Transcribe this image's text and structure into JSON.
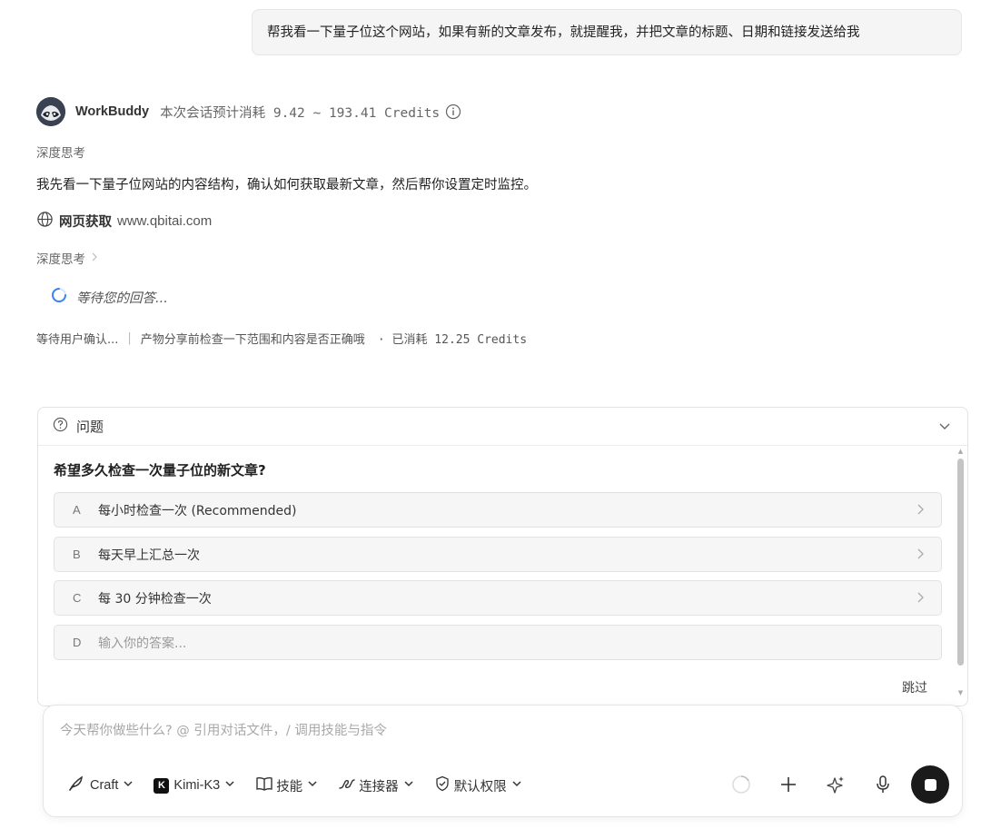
{
  "user_message": "帮我看一下量子位这个网站，如果有新的文章发布，就提醒我，并把文章的标题、日期和链接发送给我",
  "assistant": {
    "name": "WorkBuddy",
    "credits_estimate": "本次会话预计消耗 9.42 ~ 193.41 Credits",
    "avatar_icon": "raccoon-avatar-icon"
  },
  "thinking_label_1": "深度思考",
  "reply_text": "我先看一下量子位网站的内容结构，确认如何获取最新文章，然后帮你设置定时监控。",
  "web_fetch": {
    "label": "网页获取",
    "url": "www.qbitai.com"
  },
  "thinking_label_2": "深度思考",
  "waiting_text": "等待您的回答...",
  "status": {
    "state": "等待用户确认...",
    "hint": "产物分享前检查一下范围和内容是否正确哦",
    "consumed": "· 已消耗 12.25 Credits"
  },
  "question_panel": {
    "title": "问题",
    "question": "希望多久检查一次量子位的新文章?",
    "options": [
      {
        "key": "A",
        "label": "每小时检查一次 (Recommended)"
      },
      {
        "key": "B",
        "label": "每天早上汇总一次"
      },
      {
        "key": "C",
        "label": "每 30 分钟检查一次"
      }
    ],
    "custom": {
      "key": "D",
      "placeholder": "输入你的答案..."
    },
    "skip": "跳过"
  },
  "composer": {
    "placeholder": "今天帮你做些什么? @ 引用对话文件，/ 调用技能与指令",
    "mode": "Craft",
    "model_badge": "K",
    "model": "Kimi-K3",
    "skills": "技能",
    "connectors": "连接器",
    "permissions": "默认权限"
  },
  "colors": {
    "accent": "#1a1a1a",
    "bubble_bg": "#f5f5f5",
    "option_bg": "#f6f6f6",
    "spinner": "#3b82f6"
  }
}
